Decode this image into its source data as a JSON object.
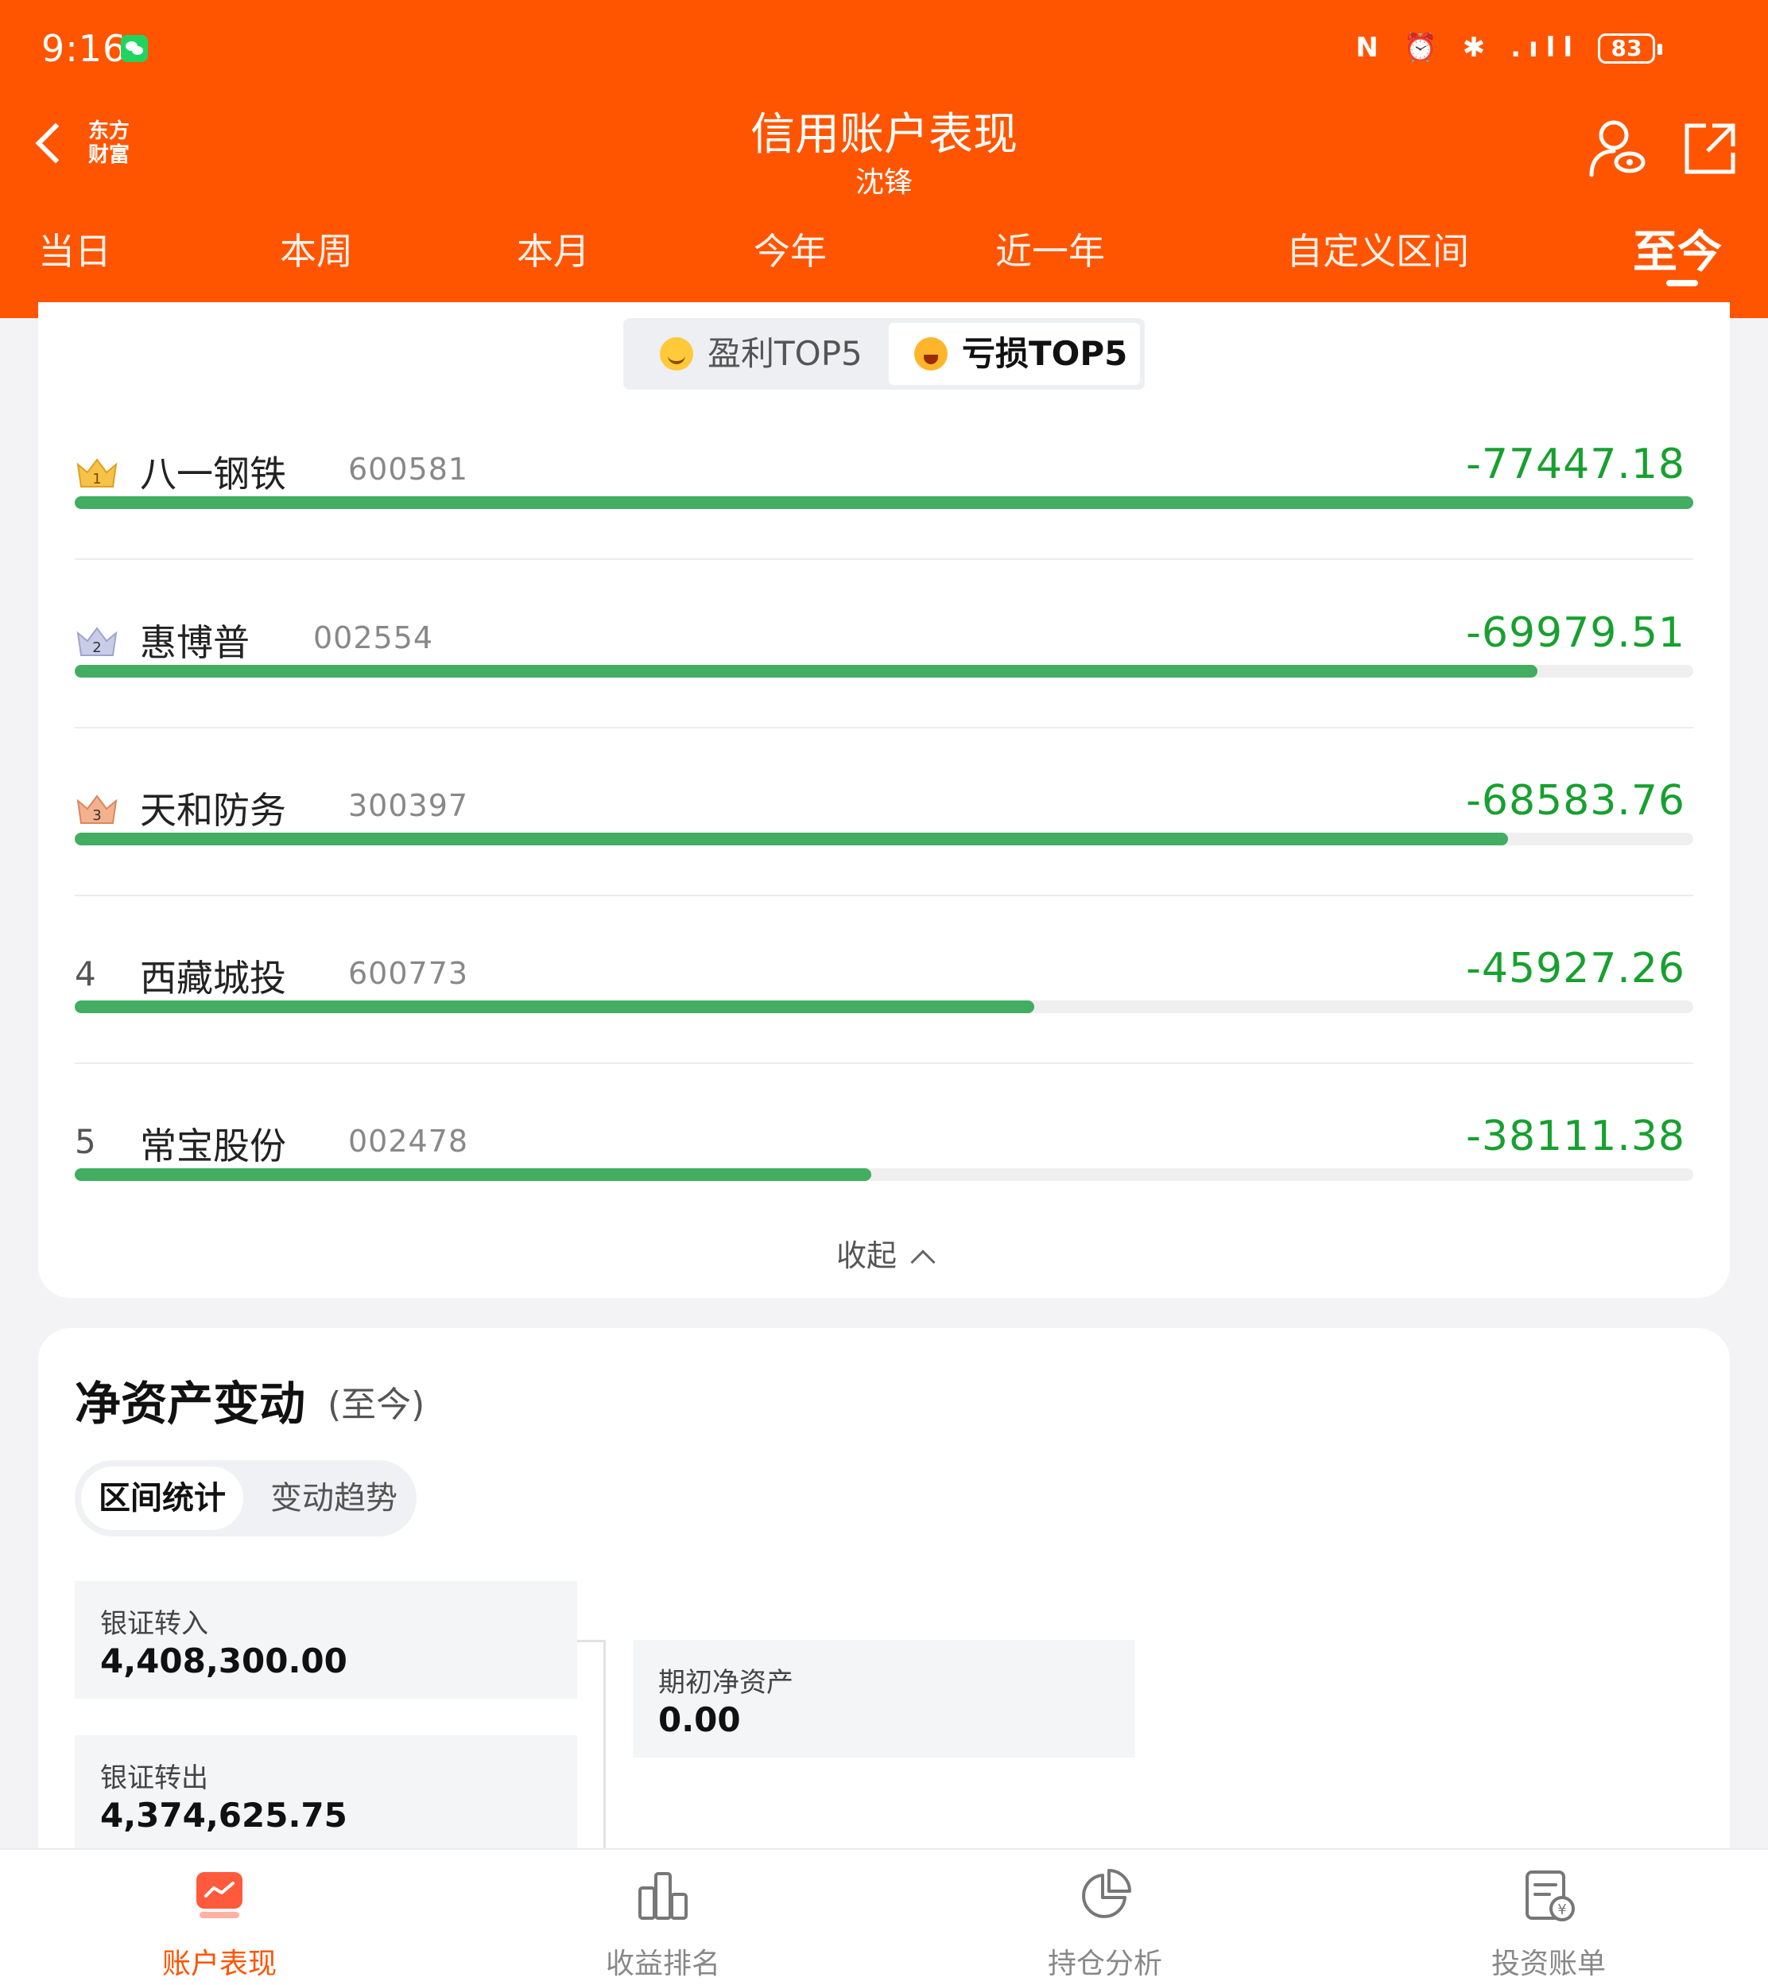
{
  "status_bar": {
    "time": "9:16",
    "icons": "N ⏰ ✱ .ıll",
    "battery": "83"
  },
  "header": {
    "logo_text": "东方\n财富",
    "title": "信用账户表现",
    "subtitle": "沈锋"
  },
  "period_tabs": [
    {
      "label": "当日",
      "active": false
    },
    {
      "label": "本周",
      "active": false
    },
    {
      "label": "本月",
      "active": false
    },
    {
      "label": "今年",
      "active": false
    },
    {
      "label": "近一年",
      "active": false
    },
    {
      "label": "自定义区间",
      "active": false
    },
    {
      "label": "至今",
      "active": true
    }
  ],
  "top5": {
    "tabs": [
      {
        "label": "盈利TOP5",
        "active": false
      },
      {
        "label": "亏损TOP5",
        "active": true
      }
    ],
    "items": [
      {
        "rank": "1",
        "name": "八一钢铁",
        "code": "600581",
        "value": "-77447.18",
        "ratio": 1.0
      },
      {
        "rank": "2",
        "name": "惠博普",
        "code": "002554",
        "value": "-69979.51",
        "ratio": 0.9036
      },
      {
        "rank": "3",
        "name": "天和防务",
        "code": "300397",
        "value": "-68583.76",
        "ratio": 0.8856
      },
      {
        "rank": "4",
        "name": "西藏城投",
        "code": "600773",
        "value": "-45927.26",
        "ratio": 0.593
      },
      {
        "rank": "5",
        "name": "常宝股份",
        "code": "002478",
        "value": "-38111.38",
        "ratio": 0.4921
      }
    ],
    "collapse_label": "收起"
  },
  "net_asset": {
    "title": "净资产变动",
    "subtitle": "(至今)",
    "tabs": [
      {
        "label": "区间统计",
        "active": true
      },
      {
        "label": "变动趋势",
        "active": false
      }
    ],
    "stats": {
      "transfer_in": {
        "label": "银证转入",
        "value": "4,408,300.00"
      },
      "transfer_out": {
        "label": "银证转出",
        "value": "4,374,625.75"
      },
      "opening": {
        "label": "期初净资产",
        "value": "0.00"
      }
    }
  },
  "bottom_nav": [
    {
      "label": "账户表现",
      "icon": "chart-card-icon",
      "active": true
    },
    {
      "label": "收益排名",
      "icon": "bar-ranking-icon",
      "active": false
    },
    {
      "label": "持仓分析",
      "icon": "pie-chart-icon",
      "active": false
    },
    {
      "label": "投资账单",
      "icon": "bill-icon",
      "active": false
    }
  ],
  "colors": {
    "brand": "#ff5500",
    "loss": "#17a02f",
    "bar": "#43ad61"
  }
}
